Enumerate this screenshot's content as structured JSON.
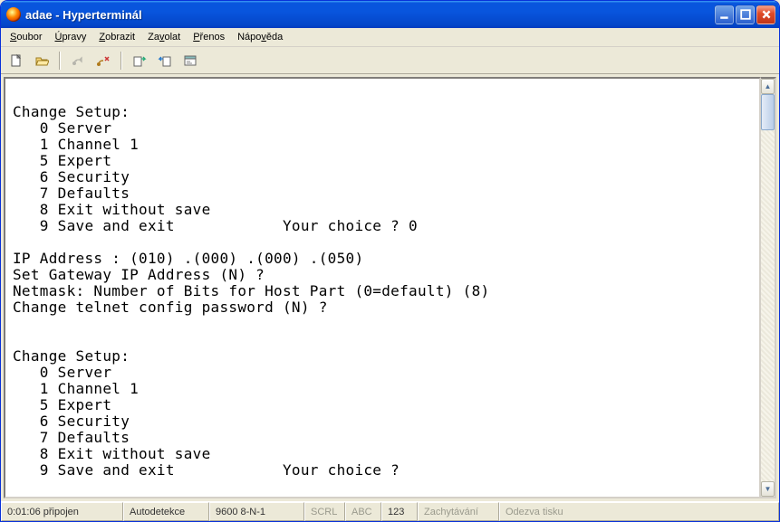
{
  "window": {
    "title": "adae - Hyperterminál"
  },
  "menu": {
    "items": [
      {
        "u": "S",
        "rest": "oubor"
      },
      {
        "u": "Ú",
        "rest": "pravy"
      },
      {
        "u": "Z",
        "rest": "obrazit"
      },
      {
        "u": "",
        "rest": "Za",
        "u2": "v",
        "rest2": "olat"
      },
      {
        "u": "P",
        "rest": "řenos",
        "pre": ""
      },
      {
        "u": "",
        "rest": "",
        "raw": "Nápověda",
        "upos": 4
      }
    ],
    "m0": "Soubor",
    "m1": "Úpravy",
    "m2": "Zobrazit",
    "m3": "Zavolat",
    "m4": "Přenos",
    "m5": "Nápověda"
  },
  "terminal_text": "\nChange Setup:\n   0 Server\n   1 Channel 1\n   5 Expert\n   6 Security\n   7 Defaults\n   8 Exit without save\n   9 Save and exit            Your choice ? 0\n\nIP Address : (010) .(000) .(000) .(050)\nSet Gateway IP Address (N) ?\nNetmask: Number of Bits for Host Part (0=default) (8)\nChange telnet config password (N) ?\n\n\nChange Setup:\n   0 Server\n   1 Channel 1\n   5 Expert\n   6 Security\n   7 Defaults\n   8 Exit without save\n   9 Save and exit            Your choice ?",
  "status": {
    "time": "0:01:06 připojen",
    "detect": "Autodetekce",
    "conn": "9600 8-N-1",
    "scrl": "SCRL",
    "abc": "ABC",
    "num": "123",
    "capture": "Zachytávání",
    "echo": "Odezva tisku"
  }
}
